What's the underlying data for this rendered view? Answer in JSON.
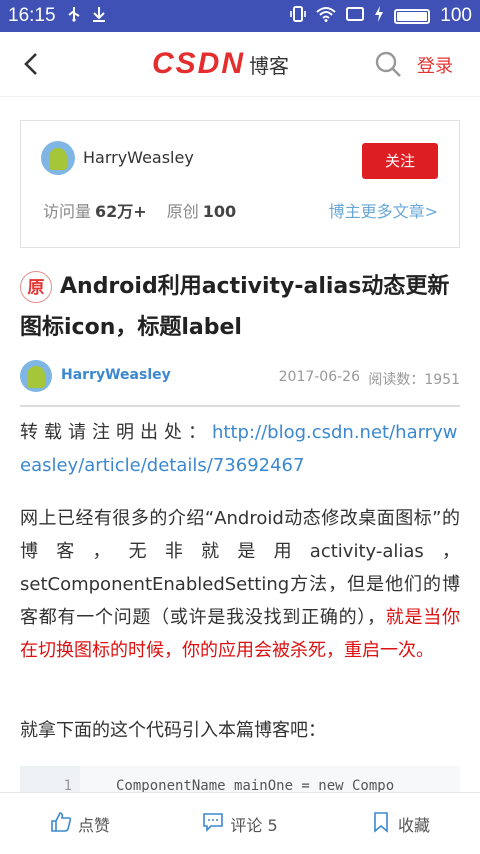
{
  "status_bar": {
    "time": "16:15",
    "battery": "100",
    "battery_level": 1.0,
    "icons": [
      "usb-icon",
      "download-icon",
      "vibrate-icon",
      "wifi-icon",
      "cast-icon",
      "charging-icon",
      "battery-icon"
    ]
  },
  "nav": {
    "logo_text": "CSDN",
    "logo_sub": "博客",
    "login": "登录"
  },
  "author": {
    "name": "HarryWeasley",
    "follow_label": "关注",
    "visits_label": "访问量",
    "visits_value": "62万+",
    "original_label": "原创",
    "original_value": "100",
    "more_link": "博主更多文章>"
  },
  "article": {
    "badge": "原",
    "title": "Android利用activity-alias动态更新图标icon，标题label",
    "author": "HarryWeasley",
    "date": "2017-06-26",
    "reads_label": "阅读数：",
    "reads_value": "1951",
    "repost_label": "转载请注明出处：",
    "repost_url": "http://blog.csdn.net/harryweasley/article/details/73692467",
    "p2_normal": "网上已经有很多的介绍“Android动态修改桌面图标”的博客，无非就是用activity-alias，setComponentEnabledSetting方法，但是他们的博客都有一个问题（或许是我没找到正确的），",
    "p2_red": "就是当你在切换图标的时候，你的应用会被杀死，重启一次。",
    "p3": "就拿下面的这个代码引入本篇博客吧：",
    "code_line_no": "1",
    "code_line": "ComponentName mainOne = new Compo"
  },
  "bottom_bar": {
    "like": "点赞",
    "comment": "评论 5",
    "favorite": "收藏"
  },
  "colors": {
    "status_bar": "#3f51b5",
    "accent_red": "#dd1f24",
    "link_blue": "#3b88d0"
  }
}
